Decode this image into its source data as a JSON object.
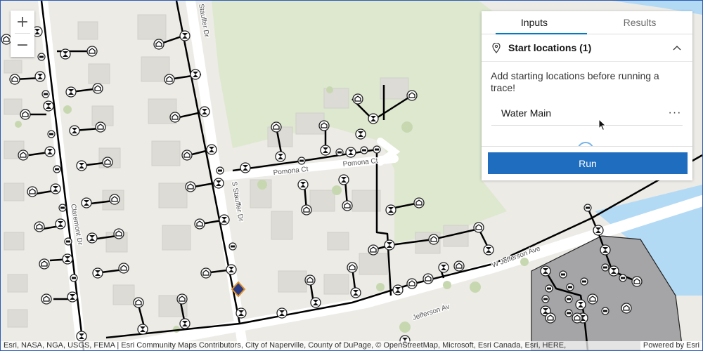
{
  "zoom": {
    "in_label": "+",
    "out_label": "−"
  },
  "panel": {
    "tabs": [
      {
        "label": "Inputs",
        "active": true
      },
      {
        "label": "Results",
        "active": false
      }
    ],
    "section_title": "Start locations (1)",
    "message": "Add starting locations before running a trace!",
    "start_location": "Water Main",
    "more_label": "···",
    "run_label": "Run"
  },
  "map": {
    "streets": [
      "Pomona Ct",
      "Pomona Ct",
      "S Stauffer Dr",
      "Claremont Dr",
      "W Jefferson Ave",
      "Jefferson Av",
      "Stauffer Dr"
    ],
    "colors": {
      "land": "#ecebe6",
      "park": "#dde8cf",
      "water": "#b3daf5",
      "line": "#000000",
      "selection": "#a5a5a8",
      "marker_fill": "#2a3b85",
      "marker_stroke": "#e0932c"
    }
  },
  "attribution": {
    "credits": "Esri, NASA, NGA, USGS, FEMA | Esri Community Maps Contributors, City of Naperville, County of DuPage, © OpenStreetMap, Microsoft, Esri Canada, Esri, HERE,",
    "powered": "Powered by Esri"
  }
}
